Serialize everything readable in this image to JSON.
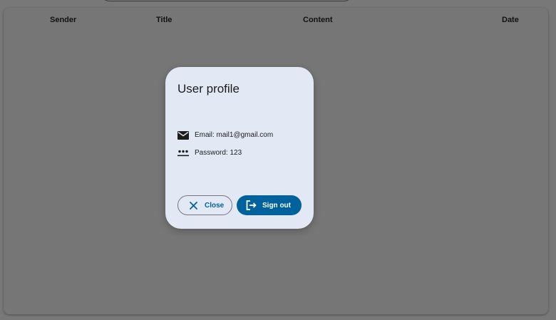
{
  "table": {
    "columns": [
      "Sender",
      "Title",
      "Content",
      "Date"
    ]
  },
  "dialog": {
    "title": "User profile",
    "email_text": "Email: mail1@gmail.com",
    "password_text": "Password: 123",
    "close_label": "Close",
    "signout_label": "Sign out"
  },
  "icons": {
    "email": "mail-icon",
    "password": "password-icon",
    "close": "close-icon",
    "signout": "logout-icon"
  },
  "colors": {
    "primary": "#00629d",
    "dialog_bg": "#e3e9f4",
    "scrim": "#787878"
  }
}
